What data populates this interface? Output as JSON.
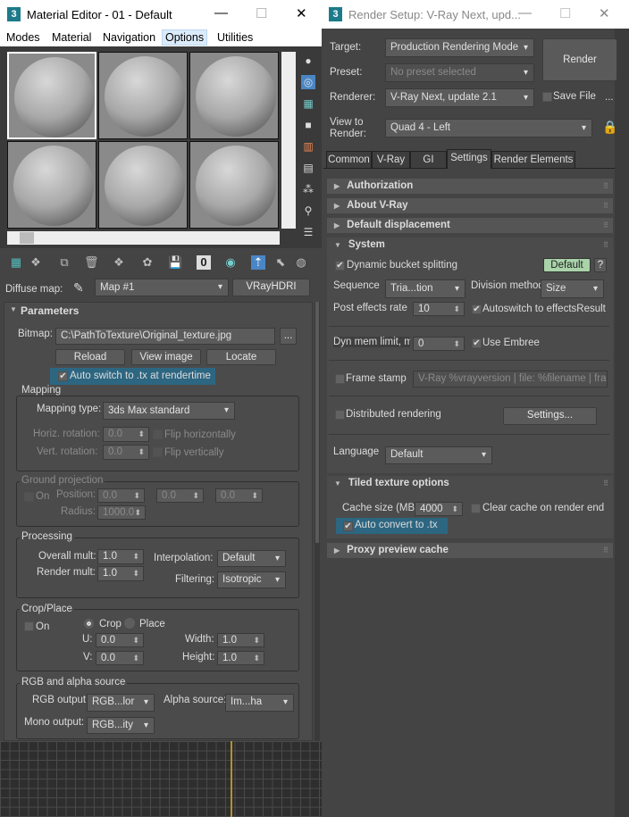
{
  "material_editor": {
    "title": "Material Editor - 01 - Default",
    "menu": [
      "Modes",
      "Material",
      "Navigation",
      "Options",
      "Utilities"
    ],
    "active_menu": "Options",
    "diffuse_map_label": "Diffuse map:",
    "map_name": "Map #1",
    "map_type": "VRayHDRI",
    "parameters": {
      "title": "Parameters",
      "bitmap_label": "Bitmap:",
      "bitmap_path": "C:\\PathToTexture\\Original_texture.jpg",
      "browse": "...",
      "reload": "Reload",
      "view_image": "View image",
      "locate": "Locate",
      "auto_switch": "Auto switch to .tx at rendertime",
      "auto_switch_checked": true,
      "mapping": {
        "title": "Mapping",
        "type_label": "Mapping type:",
        "type": "3ds Max standard",
        "horiz_label": "Horiz. rotation:",
        "horiz": "0.0",
        "flip_h": "Flip horizontally",
        "vert_label": "Vert. rotation:",
        "vert": "0.0",
        "flip_v": "Flip vertically"
      },
      "ground": {
        "title": "Ground projection",
        "on": "On",
        "position_label": "Position:",
        "position": [
          "0.0",
          "0.0",
          "0.0"
        ],
        "radius_label": "Radius:",
        "radius": "1000.0"
      },
      "processing": {
        "title": "Processing",
        "overall_label": "Overall mult:",
        "overall": "1.0",
        "render_label": "Render mult:",
        "render": "1.0",
        "interp_label": "Interpolation:",
        "interp": "Default",
        "filter_label": "Filtering:",
        "filter": "Isotropic"
      },
      "crop": {
        "title": "Crop/Place",
        "on": "On",
        "crop": "Crop",
        "place": "Place",
        "selected": "Crop",
        "u_label": "U:",
        "u": "0.0",
        "v_label": "V:",
        "v": "0.0",
        "width_label": "Width:",
        "width": "1.0",
        "height_label": "Height:",
        "height": "1.0"
      },
      "rgb": {
        "title": "RGB and alpha source",
        "rgb_label": "RGB output:",
        "rgb": "RGB...lor",
        "alpha_label": "Alpha source:",
        "alpha": "Im...ha",
        "mono_label": "Mono output:",
        "mono": "RGB...ity"
      }
    }
  },
  "render_setup": {
    "title": "Render Setup: V-Ray Next, upd...",
    "target_label": "Target:",
    "target": "Production Rendering Mode",
    "preset_label": "Preset:",
    "preset_placeholder": "No preset selected",
    "renderer_label": "Renderer:",
    "renderer": "V-Ray Next, update 2.1",
    "save_file": "Save File",
    "more": "...",
    "view_label": "View to Render:",
    "view": "Quad 4 - Left",
    "render_button": "Render",
    "tabs": [
      "Common",
      "V-Ray",
      "GI",
      "Settings",
      "Render Elements"
    ],
    "active_tab": "Settings",
    "rollouts": {
      "authorization": "Authorization",
      "about": "About V-Ray",
      "displacement": "Default displacement",
      "system": "System",
      "tiled": "Tiled texture options",
      "proxy": "Proxy preview cache"
    },
    "system": {
      "dynamic_bucket": "Dynamic bucket splitting",
      "default_btn": "Default",
      "help": "?",
      "sequence_label": "Sequence",
      "sequence": "Tria...tion",
      "division_label": "Division method",
      "division": "Size",
      "post_label": "Post effects rate",
      "post": "10",
      "autoswitch": "Autoswitch to effectsResult",
      "dynmem_label": "Dyn mem limit, mb",
      "dynmem": "0",
      "embree": "Use Embree",
      "frame_stamp": "Frame stamp",
      "frame_stamp_text": "V-Ray %vrayversion | file: %filename | fram",
      "distributed": "Distributed rendering",
      "settings_btn": "Settings...",
      "language_label": "Language",
      "language": "Default"
    },
    "tiled": {
      "cache_label": "Cache size (MB):",
      "cache": "4000",
      "clear_cache": "Clear cache on render end",
      "auto_convert": "Auto convert to .tx"
    }
  },
  "colors": {
    "highlight": "#2d6681",
    "default_btn": "#a9d3a9",
    "active_toolbar": "#4a86c5"
  }
}
